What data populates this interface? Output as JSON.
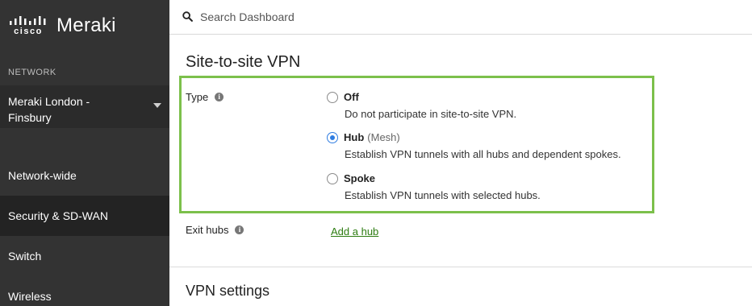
{
  "brand": {
    "vendor": "cisco",
    "product": "Meraki"
  },
  "sidebar": {
    "section_label": "NETWORK",
    "network_name": "Meraki London - Finsbury",
    "items": [
      {
        "label": "Network-wide"
      },
      {
        "label": "Security & SD-WAN",
        "active": true
      },
      {
        "label": "Switch"
      },
      {
        "label": "Wireless"
      }
    ]
  },
  "search": {
    "placeholder": "Search Dashboard",
    "value": ""
  },
  "main": {
    "title": "Site-to-site VPN",
    "type_label": "Type",
    "type_options": [
      {
        "label": "Off",
        "sub": "",
        "description": "Do not participate in site-to-site VPN.",
        "checked": false
      },
      {
        "label": "Hub",
        "sub": "(Mesh)",
        "description": "Establish VPN tunnels with all hubs and dependent spokes.",
        "checked": true
      },
      {
        "label": "Spoke",
        "sub": "",
        "description": "Establish VPN tunnels with selected hubs.",
        "checked": false
      }
    ],
    "exit_hubs_label": "Exit hubs",
    "add_hub_link": "Add a hub",
    "vpn_settings_title": "VPN settings"
  },
  "icons": {
    "info": "i",
    "info_icon": "info-icon",
    "search_icon": "search-icon",
    "caret_icon": "chevron-down-icon",
    "logo_icon": "cisco-logo-icon"
  },
  "colors": {
    "sidebar_bg": "#333333",
    "highlight_border": "#7cc04b",
    "link": "#2d7c11",
    "radio_checked": "#2f7de1"
  }
}
